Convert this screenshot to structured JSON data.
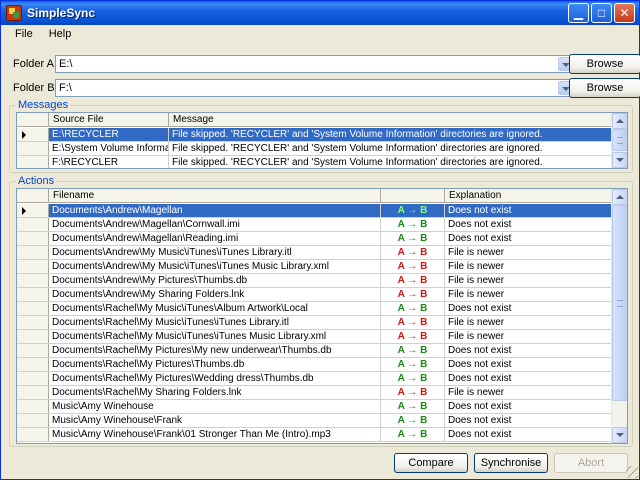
{
  "window": {
    "title": "SimpleSync"
  },
  "menu": [
    {
      "label": "File"
    },
    {
      "label": "Help"
    }
  ],
  "folders": {
    "a": {
      "label": "Folder A:",
      "value": "E:\\",
      "browse_label": "Browse"
    },
    "b": {
      "label": "Folder B:",
      "value": "F:\\",
      "browse_label": "Browse"
    }
  },
  "messages": {
    "legend": "Messages",
    "columns": [
      "Source File",
      "Message"
    ],
    "rows": [
      {
        "source": "E:\\RECYCLER",
        "message": "File skipped. 'RECYCLER' and 'System Volume Information' directories are ignored.",
        "selected": true
      },
      {
        "source": "E:\\System Volume Information",
        "message": "File skipped. 'RECYCLER' and 'System Volume Information' directories are ignored.",
        "selected": false
      },
      {
        "source": "F:\\RECYCLER",
        "message": "File skipped. 'RECYCLER' and 'System Volume Information' directories are ignored.",
        "selected": false
      }
    ]
  },
  "actions": {
    "legend": "Actions",
    "columns": [
      "Filename",
      "",
      "Explanation"
    ],
    "rows": [
      {
        "filename": "Documents\\Andrew\\Magellan",
        "direction": "A → B",
        "dir": "ab",
        "explanation": "Does not exist",
        "selected": true
      },
      {
        "filename": "Documents\\Andrew\\Magellan\\Cornwall.imi",
        "direction": "A → B",
        "dir": "ab",
        "explanation": "Does not exist",
        "selected": false
      },
      {
        "filename": "Documents\\Andrew\\Magellan\\Reading.imi",
        "direction": "A → B",
        "dir": "ab",
        "explanation": "Does not exist",
        "selected": false
      },
      {
        "filename": "Documents\\Andrew\\My Music\\iTunes\\iTunes Library.itl",
        "direction": "A → B",
        "dir": "ba",
        "explanation": "File is newer",
        "selected": false
      },
      {
        "filename": "Documents\\Andrew\\My Music\\iTunes\\iTunes Music Library.xml",
        "direction": "A → B",
        "dir": "ba",
        "explanation": "File is newer",
        "selected": false
      },
      {
        "filename": "Documents\\Andrew\\My Pictures\\Thumbs.db",
        "direction": "A → B",
        "dir": "ba",
        "explanation": "File is newer",
        "selected": false
      },
      {
        "filename": "Documents\\Andrew\\My Sharing Folders.lnk",
        "direction": "A → B",
        "dir": "ba",
        "explanation": "File is newer",
        "selected": false
      },
      {
        "filename": "Documents\\Rachel\\My Music\\iTunes\\Album Artwork\\Local",
        "direction": "A → B",
        "dir": "ab",
        "explanation": "Does not exist",
        "selected": false
      },
      {
        "filename": "Documents\\Rachel\\My Music\\iTunes\\iTunes Library.itl",
        "direction": "A → B",
        "dir": "ba",
        "explanation": "File is newer",
        "selected": false
      },
      {
        "filename": "Documents\\Rachel\\My Music\\iTunes\\iTunes Music Library.xml",
        "direction": "A → B",
        "dir": "ba",
        "explanation": "File is newer",
        "selected": false
      },
      {
        "filename": "Documents\\Rachel\\My Pictures\\My new underwear\\Thumbs.db",
        "direction": "A → B",
        "dir": "ab",
        "explanation": "Does not exist",
        "selected": false
      },
      {
        "filename": "Documents\\Rachel\\My Pictures\\Thumbs.db",
        "direction": "A → B",
        "dir": "ab",
        "explanation": "Does not exist",
        "selected": false
      },
      {
        "filename": "Documents\\Rachel\\My Pictures\\Wedding dress\\Thumbs.db",
        "direction": "A → B",
        "dir": "ab",
        "explanation": "Does not exist",
        "selected": false
      },
      {
        "filename": "Documents\\Rachel\\My Sharing Folders.lnk",
        "direction": "A → B",
        "dir": "ba",
        "explanation": "File is newer",
        "selected": false
      },
      {
        "filename": "Music\\Amy Winehouse",
        "direction": "A → B",
        "dir": "ab",
        "explanation": "Does not exist",
        "selected": false
      },
      {
        "filename": "Music\\Amy Winehouse\\Frank",
        "direction": "A → B",
        "dir": "ab",
        "explanation": "Does not exist",
        "selected": false
      },
      {
        "filename": "Music\\Amy Winehouse\\Frank\\01 Stronger Than Me (Intro).mp3",
        "direction": "A → B",
        "dir": "ab",
        "explanation": "Does not exist",
        "selected": false
      }
    ]
  },
  "buttons": {
    "compare": "Compare",
    "synchronise": "Synchronise",
    "abort": "Abort"
  },
  "colors": {
    "direction_green": "#1A8A1A",
    "direction_red": "#D01818",
    "selection": "#316AC5"
  }
}
